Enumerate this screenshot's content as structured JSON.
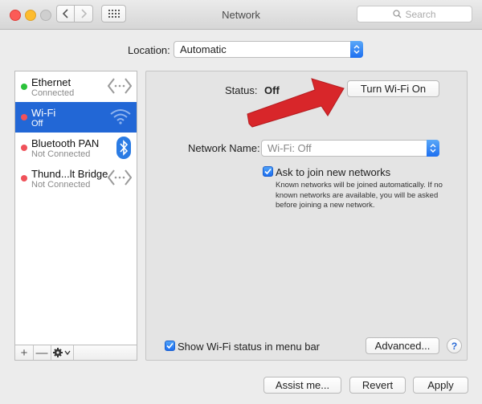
{
  "window": {
    "title": "Network",
    "search_placeholder": "Search"
  },
  "location": {
    "label": "Location:",
    "value": "Automatic"
  },
  "services": [
    {
      "name": "Ethernet",
      "status": "Connected",
      "dot_color": "#2bc23a",
      "icon": "ethernet-arrows-icon"
    },
    {
      "name": "Wi-Fi",
      "status": "Off",
      "dot_color": "#f0525a",
      "icon": "wifi-icon",
      "selected": true
    },
    {
      "name": "Bluetooth PAN",
      "status": "Not Connected",
      "dot_color": "#f0525a",
      "icon": "bluetooth-icon"
    },
    {
      "name": "Thund...lt Bridge",
      "status": "Not Connected",
      "dot_color": "#f0525a",
      "icon": "thunderbolt-arrows-icon"
    }
  ],
  "sidebar_tools": {
    "add": "+",
    "remove": "—"
  },
  "panel": {
    "status_label": "Status:",
    "status_value": "Off",
    "turn_wifi_button": "Turn Wi-Fi On",
    "network_name_label": "Network Name:",
    "network_name_value": "Wi-Fi: Off",
    "ask_to_join_label": "Ask to join new networks",
    "ask_to_join_checked": true,
    "help_text": "Known networks will be joined automatically. If no known networks are available, you will be asked before joining a new network.",
    "show_status_label": "Show Wi-Fi status in menu bar",
    "show_status_checked": true,
    "advanced_button": "Advanced...",
    "help_button": "?"
  },
  "footer": {
    "assist_button": "Assist me...",
    "revert_button": "Revert",
    "apply_button": "Apply"
  },
  "colors": {
    "accent_blue": "#2267d6",
    "annotation_arrow": "#d8262a"
  }
}
